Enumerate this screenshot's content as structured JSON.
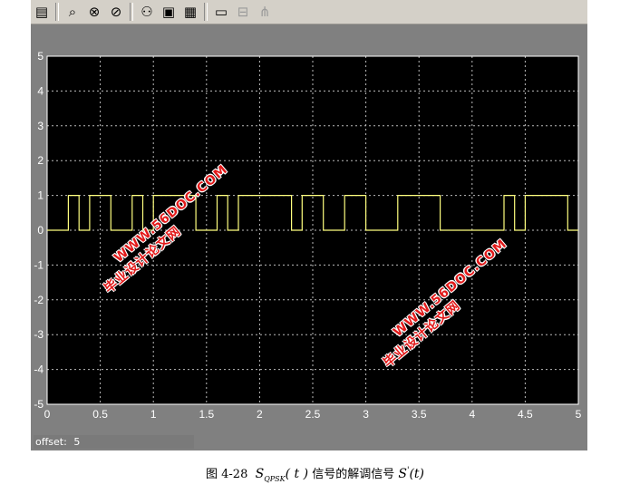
{
  "toolbar": {
    "items": [
      {
        "name": "parameters-icon",
        "glyph": "▤",
        "enabled": true
      },
      {
        "name": "zoom-icon",
        "glyph": "⌕",
        "enabled": true
      },
      {
        "name": "zoom-x-icon",
        "glyph": "⊗",
        "enabled": true
      },
      {
        "name": "zoom-y-icon",
        "glyph": "⊘",
        "enabled": true
      },
      {
        "name": "autoscale-icon",
        "glyph": "⚇",
        "enabled": true
      },
      {
        "name": "save-axes-icon",
        "glyph": "▣",
        "enabled": true
      },
      {
        "name": "restore-axes-icon",
        "glyph": "▦",
        "enabled": true
      },
      {
        "name": "floating-scope-icon",
        "glyph": "▭",
        "enabled": true
      },
      {
        "name": "lock-axes-icon",
        "glyph": "⊟",
        "enabled": false
      },
      {
        "name": "signal-selection-icon",
        "glyph": "⋔",
        "enabled": false
      }
    ]
  },
  "scope": {
    "offset_label": "offset:",
    "offset_value": "5",
    "background": "#000000",
    "trace_color": "#ffff7f",
    "grid_color": "#bbbbbb"
  },
  "chart_data": {
    "type": "line",
    "step": true,
    "xlim": [
      0,
      5
    ],
    "ylim": [
      -5,
      5
    ],
    "xticks": [
      "0",
      "0.5",
      "1",
      "1.5",
      "2",
      "2.5",
      "3",
      "3.5",
      "4",
      "4.5",
      "5"
    ],
    "yticks": [
      "5",
      "4",
      "3",
      "2",
      "1",
      "0",
      "-1",
      "-2",
      "-3",
      "-4",
      "-5"
    ],
    "grid": true,
    "series": [
      {
        "x": [
          0,
          0.2,
          0.2,
          0.3,
          0.3,
          0.4,
          0.4,
          0.6,
          0.6,
          0.8,
          0.8,
          0.9,
          0.9,
          1.0,
          1.0,
          1.4,
          1.4,
          1.6,
          1.6,
          1.7,
          1.7,
          1.8,
          1.8,
          2.3,
          2.3,
          2.4,
          2.4,
          2.6,
          2.6,
          2.8,
          2.8,
          3.0,
          3.0,
          3.3,
          3.3,
          3.7,
          3.7,
          4.3,
          4.3,
          4.4,
          4.4,
          4.5,
          4.5,
          4.9,
          4.9,
          5.0
        ],
        "y": [
          0,
          0,
          1,
          1,
          0,
          0,
          1,
          1,
          0,
          0,
          1,
          1,
          0,
          0,
          1,
          1,
          0,
          0,
          1,
          1,
          0,
          0,
          1,
          1,
          0,
          0,
          1,
          1,
          0,
          0,
          1,
          1,
          0,
          0,
          1,
          1,
          0,
          0,
          1,
          1,
          0,
          0,
          1,
          1,
          0,
          0
        ]
      }
    ]
  },
  "watermarks": [
    {
      "line1": "WWW.56DOC.COM",
      "line2": "毕业设计论文网"
    },
    {
      "line1": "WWW.56DOC.COM",
      "line2": "毕业设计论文网"
    }
  ],
  "caption": {
    "figure": "图 4-28",
    "symbol1": "S",
    "sub1": "QPSK",
    "arg1": "( t )",
    "text": "信号的解调信号",
    "symbol2": "S",
    "sup2": "'",
    "arg2": "(t)"
  }
}
